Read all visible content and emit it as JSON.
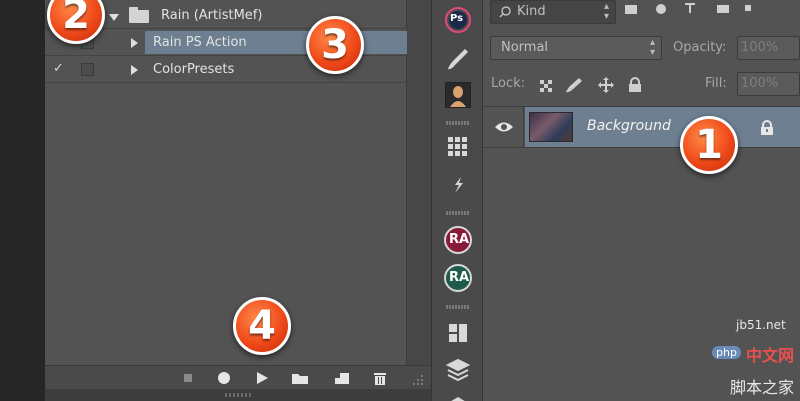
{
  "actions": {
    "rows": [
      {
        "check": "",
        "label": "Rain (ArtistMef)"
      },
      {
        "check": "",
        "label": "Rain PS Action"
      },
      {
        "check": "✓",
        "label": "ColorPresets"
      }
    ]
  },
  "layers": {
    "filter_kind": "Kind",
    "blend_mode": "Normal",
    "opacity_label": "Opacity:",
    "opacity_value": "100%",
    "lock_label": "Lock:",
    "fill_label": "Fill:",
    "fill_value": "100%",
    "layer_name": "Background"
  },
  "tools": {
    "ps_badge": "Ps",
    "ra_badge_1": "RA",
    "ra_badge_2": "RA"
  },
  "callouts": {
    "one": "1",
    "two": "2",
    "three": "3",
    "four": "4"
  },
  "watermark": {
    "site": "jb51.net",
    "php_label": "php",
    "cn_text": "中文网",
    "cn_sub": "脚本之家"
  },
  "colors": {
    "selection": "#6e7f91",
    "panel": "#535353",
    "callout": "#f04a1a"
  }
}
